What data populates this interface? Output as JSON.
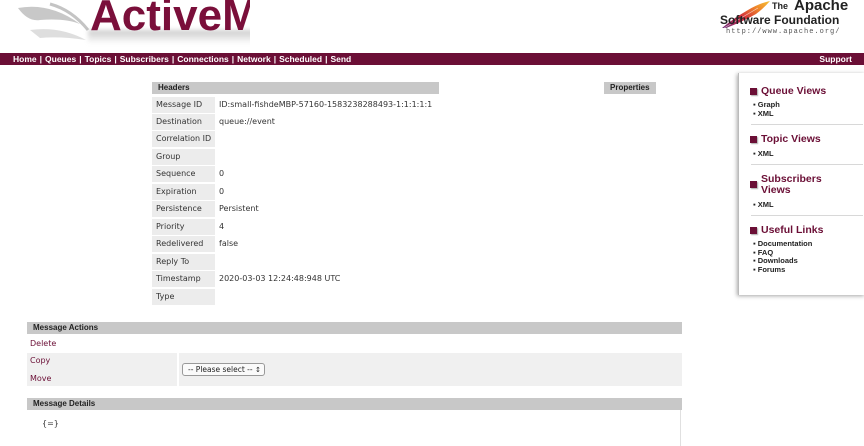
{
  "header": {
    "logo_text": "ActiveMQ",
    "apache_the": "The",
    "apache_name": "Apache",
    "apache_foundation": "Software Foundation",
    "apache_url": "http://www.apache.org/"
  },
  "nav": {
    "links": [
      "Home",
      "Queues",
      "Topics",
      "Subscribers",
      "Connections",
      "Network",
      "Scheduled",
      "Send"
    ],
    "support": "Support"
  },
  "headers_section": {
    "title": "Headers",
    "properties_title": "Properties",
    "rows": [
      {
        "label": "Message ID",
        "value": "ID:small-fishdeMBP-57160-1583238288493-1:1:1:1:1"
      },
      {
        "label": "Destination",
        "value": "queue://event"
      },
      {
        "label": "Correlation ID",
        "value": ""
      },
      {
        "label": "Group",
        "value": ""
      },
      {
        "label": "Sequence",
        "value": "0"
      },
      {
        "label": "Expiration",
        "value": "0"
      },
      {
        "label": "Persistence",
        "value": "Persistent"
      },
      {
        "label": "Priority",
        "value": "4"
      },
      {
        "label": "Redelivered",
        "value": "false"
      },
      {
        "label": "Reply To",
        "value": ""
      },
      {
        "label": "Timestamp",
        "value": "2020-03-03 12:24:48:948 UTC"
      },
      {
        "label": "Type",
        "value": ""
      }
    ]
  },
  "actions": {
    "title": "Message Actions",
    "delete": "Delete",
    "copy": "Copy",
    "move": "Move",
    "select_value": "-- Please select --",
    "select_arrows": "↕"
  },
  "details": {
    "title": "Message Details",
    "body": "{=}"
  },
  "sidebar": {
    "queue_views": {
      "title": "Queue Views",
      "items": [
        "Graph",
        "XML"
      ]
    },
    "topic_views": {
      "title": "Topic Views",
      "items": [
        "XML"
      ]
    },
    "subscribers_views": {
      "title_line1": "Subscribers",
      "title_line2": "Views",
      "items": [
        "XML"
      ]
    },
    "useful_links": {
      "title": "Useful Links",
      "items": [
        "Documentation",
        "FAQ",
        "Downloads",
        "Forums"
      ]
    }
  },
  "colors": {
    "brand": "#6b0f36",
    "section_header_bg": "#c8c8c8",
    "label_bg": "#ececec"
  }
}
